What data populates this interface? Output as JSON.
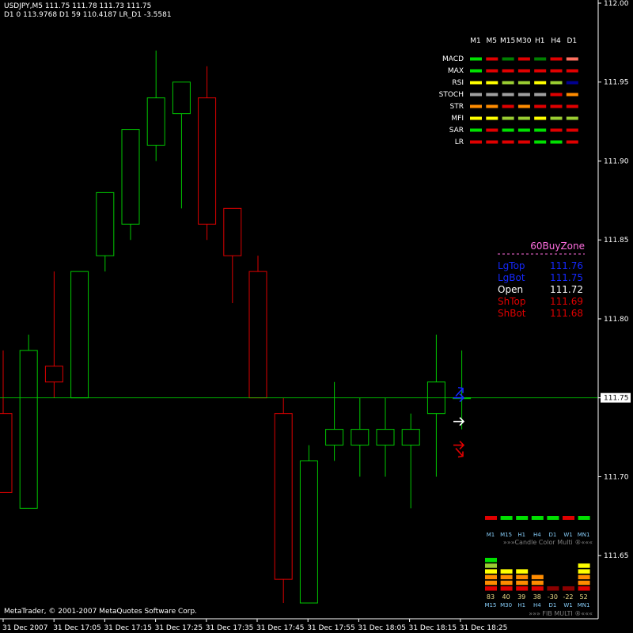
{
  "header": {
    "line1": "USDJPY,M5  111.75 111.78 111.73 111.75",
    "line2": "D1 0 113.9768 D1 59 110.4187 LR_D1 -3.5581"
  },
  "footer": {
    "copyright": "MetaTrader, © 2001-2007 MetaQuotes Software Corp."
  },
  "colors": {
    "background": "#000000",
    "axis": "#ffffff",
    "bull": "#00c800",
    "bear": "#dc0000",
    "hline": "#00c800",
    "zone_title": "#ff6ee0",
    "blue": "#1428ff",
    "red": "#e00000",
    "white": "#ffffff",
    "green": "#00e000",
    "yellow": "#ffff00",
    "orange": "#ff8c00",
    "darkred": "#8b0000",
    "olive": "#9acd32",
    "grey": "#a0a0a0",
    "darkgreen": "#008000",
    "salmon": "#ff7060",
    "navy": "#000090",
    "lightblue": "#87cefa",
    "paleyellow": "#eedd88",
    "greytext": "#7f7f7f"
  },
  "chart_data": {
    "type": "candlestick",
    "symbol": "USDJPY",
    "timeframe": "M5",
    "ylim": [
      111.61,
      112.0
    ],
    "y_ticks": [
      112.0,
      111.95,
      111.9,
      111.85,
      111.8,
      111.75,
      111.7,
      111.65
    ],
    "y_tick_labels": [
      "112.00",
      "111.95",
      "111.90",
      "111.85",
      "111.80",
      "111.75",
      "111.70",
      "111.65"
    ],
    "current_price": 111.75,
    "current_price_label": "111.75",
    "x_labels": [
      "31 Dec 2007",
      "31 Dec 17:05",
      "31 Dec 17:15",
      "31 Dec 17:25",
      "31 Dec 17:35",
      "31 Dec 17:45",
      "31 Dec 17:55",
      "31 Dec 18:05",
      "31 Dec 18:15",
      "31 Dec 18:25"
    ],
    "candles": [
      {
        "open": 111.74,
        "high": 111.78,
        "low": 111.69,
        "close": 111.69
      },
      {
        "open": 111.68,
        "high": 111.79,
        "low": 111.68,
        "close": 111.78
      },
      {
        "open": 111.77,
        "high": 111.83,
        "low": 111.75,
        "close": 111.76
      },
      {
        "open": 111.75,
        "high": 111.83,
        "low": 111.75,
        "close": 111.83
      },
      {
        "open": 111.84,
        "high": 111.86,
        "low": 111.83,
        "close": 111.88
      },
      {
        "open": 111.86,
        "high": 111.9,
        "low": 111.85,
        "close": 111.92
      },
      {
        "open": 111.91,
        "high": 111.97,
        "low": 111.9,
        "close": 111.94
      },
      {
        "open": 111.93,
        "high": 111.95,
        "low": 111.87,
        "close": 111.95
      },
      {
        "open": 111.94,
        "high": 111.96,
        "low": 111.85,
        "close": 111.86
      },
      {
        "open": 111.87,
        "high": 111.87,
        "low": 111.81,
        "close": 111.84
      },
      {
        "open": 111.83,
        "high": 111.84,
        "low": 111.75,
        "close": 111.75
      },
      {
        "open": 111.74,
        "high": 111.75,
        "low": 111.62,
        "close": 111.635
      },
      {
        "open": 111.62,
        "high": 111.72,
        "low": 111.62,
        "close": 111.71
      },
      {
        "open": 111.72,
        "high": 111.76,
        "low": 111.71,
        "close": 111.73
      },
      {
        "open": 111.72,
        "high": 111.75,
        "low": 111.7,
        "close": 111.73
      },
      {
        "open": 111.72,
        "high": 111.75,
        "low": 111.7,
        "close": 111.73
      },
      {
        "open": 111.72,
        "high": 111.74,
        "low": 111.68,
        "close": 111.73
      },
      {
        "open": 111.74,
        "high": 111.79,
        "low": 111.7,
        "close": 111.76
      },
      {
        "open": 111.75,
        "high": 111.78,
        "low": 111.73,
        "close": 111.75
      }
    ],
    "arrows": [
      {
        "price": 111.755,
        "color": "blue",
        "direction": "up"
      },
      {
        "price": 111.75,
        "color": "blue",
        "direction": "right"
      },
      {
        "price": 111.735,
        "color": "white",
        "direction": "right"
      },
      {
        "price": 111.72,
        "color": "red",
        "direction": "right"
      },
      {
        "price": 111.715,
        "color": "red",
        "direction": "down"
      }
    ]
  },
  "matrix": {
    "timeframes": [
      "M1",
      "M5",
      "M15",
      "M30",
      "H1",
      "H4",
      "D1"
    ],
    "rows": [
      {
        "label": "MACD",
        "colors": [
          "green",
          "red",
          "darkgreen",
          "red",
          "darkgreen",
          "red",
          "salmon"
        ]
      },
      {
        "label": "MAX",
        "colors": [
          "green",
          "red",
          "red",
          "red",
          "red",
          "red",
          "red"
        ]
      },
      {
        "label": "RSI",
        "colors": [
          "yellow",
          "yellow",
          "olive",
          "olive",
          "yellow",
          "olive",
          "navy"
        ]
      },
      {
        "label": "STOCH",
        "colors": [
          "grey",
          "grey",
          "grey",
          "grey",
          "grey",
          "red",
          "orange"
        ]
      },
      {
        "label": "STR",
        "colors": [
          "orange",
          "orange",
          "red",
          "orange",
          "red",
          "red",
          "red"
        ]
      },
      {
        "label": "MFI",
        "colors": [
          "yellow",
          "yellow",
          "olive",
          "olive",
          "yellow",
          "olive",
          "olive"
        ]
      },
      {
        "label": "SAR",
        "colors": [
          "green",
          "red",
          "green",
          "green",
          "green",
          "red",
          "red"
        ]
      },
      {
        "label": "LR",
        "colors": [
          "red",
          "red",
          "red",
          "red",
          "green",
          "green",
          "red"
        ]
      }
    ]
  },
  "zone": {
    "title": "60BuyZone",
    "divider": "- - - - - - - - - - -",
    "rows": [
      {
        "label": "LgTop",
        "value": "111.76",
        "color": "blue"
      },
      {
        "label": "LgBot",
        "value": "111.75",
        "color": "blue"
      },
      {
        "label": "Open",
        "value": "111.72",
        "color": "white"
      },
      {
        "label": "ShTop",
        "value": "111.69",
        "color": "red"
      },
      {
        "label": "ShBot",
        "value": "111.68",
        "color": "red"
      }
    ]
  },
  "candle_color_multi": {
    "timeframes": [
      "M1",
      "M15",
      "H1",
      "H4",
      "D1",
      "W1",
      "MN1"
    ],
    "colors": [
      "red",
      "green",
      "green",
      "green",
      "green",
      "red",
      "green"
    ],
    "caption": "»»»Candle Color Multi ®«««"
  },
  "fib_multi": {
    "bars": [
      {
        "value": "83",
        "tf": "M15",
        "level": 6,
        "colors": [
          "red",
          "orange",
          "orange",
          "yellow",
          "olive",
          "green"
        ]
      },
      {
        "value": "40",
        "tf": "M30",
        "level": 4,
        "colors": [
          "red",
          "orange",
          "orange",
          "yellow"
        ]
      },
      {
        "value": "39",
        "tf": "H1",
        "level": 4,
        "colors": [
          "red",
          "orange",
          "orange",
          "yellow"
        ]
      },
      {
        "value": "38",
        "tf": "H4",
        "level": 3,
        "colors": [
          "red",
          "orange",
          "orange"
        ]
      },
      {
        "value": "-30",
        "tf": "D1",
        "level": 1,
        "colors": [
          "darkred"
        ]
      },
      {
        "value": "-22",
        "tf": "W1",
        "level": 1,
        "colors": [
          "darkred"
        ]
      },
      {
        "value": "52",
        "tf": "MN1",
        "level": 5,
        "colors": [
          "red",
          "orange",
          "orange",
          "yellow",
          "yellow"
        ]
      }
    ],
    "caption": "»»» FIB MULTI ®«««"
  }
}
